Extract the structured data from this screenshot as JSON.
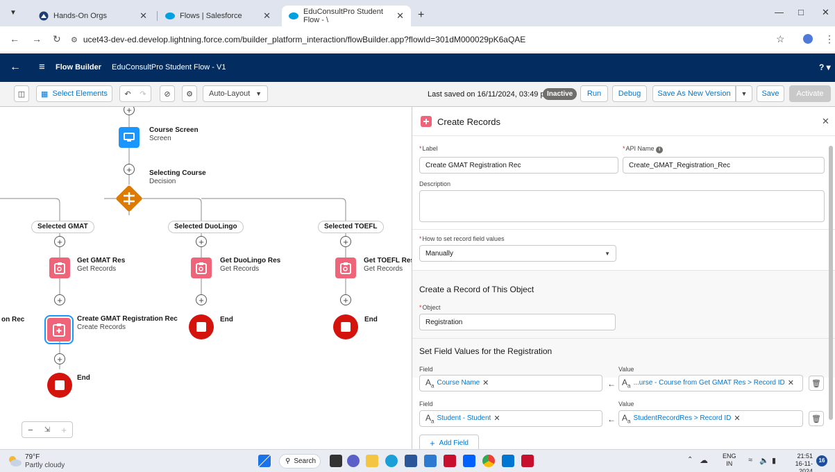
{
  "browser": {
    "tabs": [
      {
        "title": "Hands-On Orgs",
        "active": false
      },
      {
        "title": "Flows | Salesforce",
        "active": false
      },
      {
        "title": "EduConsultPro Student Flow - \\",
        "active": true
      }
    ],
    "url": "ucet43-dev-ed.develop.lightning.force.com/builder_platform_interaction/flowBuilder.app?flowId=301dM000029pK6aQAE"
  },
  "header": {
    "app_title": "Flow Builder",
    "flow_name": "EduConsultPro Student Flow - V1",
    "help": "?"
  },
  "toolbar": {
    "select_elements": "Select Elements",
    "layout": "Auto-Layout",
    "last_saved": "Last saved on 16/11/2024, 03:49 pm",
    "status": "Inactive",
    "run": "Run",
    "debug": "Debug",
    "save_as_new_version": "Save As New Version",
    "save": "Save",
    "activate": "Activate"
  },
  "canvas": {
    "course_screen": {
      "title": "Course Screen",
      "type": "Screen"
    },
    "decision": {
      "title": "Selecting Course",
      "type": "Decision"
    },
    "outcomes": [
      "Selected GMAT",
      "Selected DuoLingo",
      "Selected TOEFL"
    ],
    "get_gmat": {
      "title": "Get GMAT Res",
      "type": "Get Records"
    },
    "get_duolingo": {
      "title": "Get DuoLingo Res",
      "type": "Get Records"
    },
    "get_toefl": {
      "title": "Get TOEFL Res",
      "type": "Get Records"
    },
    "create_gmat": {
      "title": "Create GMAT Registration Rec",
      "type": "Create Records"
    },
    "cut_label": "on Rec",
    "end": "End"
  },
  "panel": {
    "title": "Create Records",
    "label_caption": "Label",
    "label_value": "Create GMAT Registration Rec",
    "api_caption": "API Name",
    "api_value": "Create_GMAT_Registration_Rec",
    "description_caption": "Description",
    "how_caption": "How to set record field values",
    "how_value": "Manually",
    "object_section": "Create a Record of This Object",
    "object_caption": "Object",
    "object_value": "Registration",
    "fields_section": "Set Field Values for the Registration",
    "field_caption": "Field",
    "value_caption": "Value",
    "rows": [
      {
        "field": "Course Name",
        "value": "...urse - Course from Get GMAT Res > Record ID"
      },
      {
        "field": "Student - Student",
        "value": "StudentRecordRes > Record ID"
      }
    ],
    "add_field": "Add Field"
  },
  "taskbar": {
    "temperature": "79°F",
    "weather": "Partly cloudy",
    "search": "Search",
    "lang": "ENG",
    "region": "IN",
    "time": "21:51",
    "date": "16-11-2024",
    "notifications": "16"
  },
  "colors": {
    "header": "#032d60",
    "accent": "#0176d3",
    "create_records": "#f0647a",
    "end": "#d4130d",
    "screen": "#1b96ff",
    "decision": "#dd7a01"
  }
}
